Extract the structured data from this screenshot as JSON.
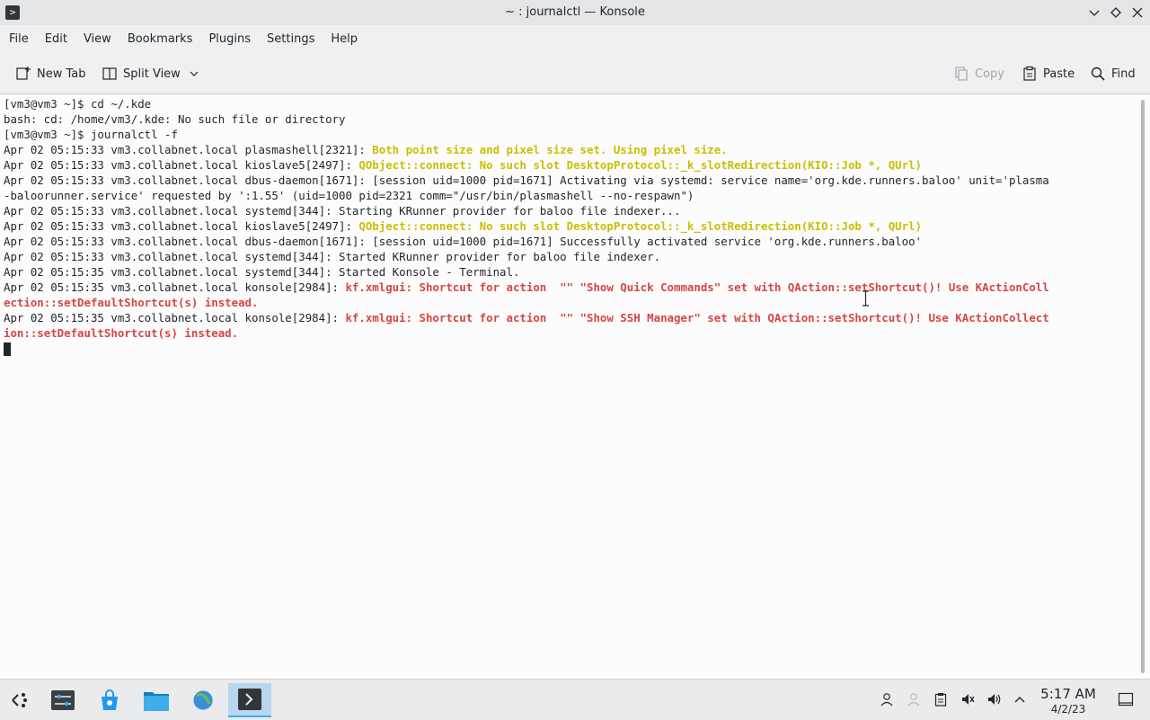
{
  "window": {
    "title": "~ : journalctl — Konsole",
    "app_icon": ">"
  },
  "window_controls": [
    "minimize",
    "maximize",
    "close"
  ],
  "menubar": {
    "items": [
      "File",
      "Edit",
      "View",
      "Bookmarks",
      "Plugins",
      "Settings",
      "Help"
    ]
  },
  "toolbar": {
    "new_tab": "New Tab",
    "split_view": "Split View",
    "copy": "Copy",
    "paste": "Paste",
    "find": "Find"
  },
  "terminal": {
    "lines": [
      {
        "prefix": "[vm3@vm3 ~]$ cd ~/.kde",
        "msg": "",
        "style": ""
      },
      {
        "prefix": "bash: cd: /home/vm3/.kde: No such file or directory",
        "msg": "",
        "style": ""
      },
      {
        "prefix": "[vm3@vm3 ~]$ journalctl -f",
        "msg": "",
        "style": ""
      },
      {
        "prefix": "Apr 02 05:15:33 vm3.collabnet.local plasmashell[2321]: ",
        "msg": "Both point size and pixel size set. Using pixel size.",
        "style": "yellow"
      },
      {
        "prefix": "Apr 02 05:15:33 vm3.collabnet.local kioslave5[2497]: ",
        "msg": "QObject::connect: No such slot DesktopProtocol::_k_slotRedirection(KIO::Job *, QUrl)",
        "style": "yellow"
      },
      {
        "prefix": "Apr 02 05:15:33 vm3.collabnet.local dbus-daemon[1671]: [session uid=1000 pid=1671] Activating via systemd: service name='org.kde.runners.baloo' unit='plasma",
        "msg": "",
        "style": ""
      },
      {
        "prefix": "-baloorunner.service' requested by ':1.55' (uid=1000 pid=2321 comm=\"/usr/bin/plasmashell --no-respawn\")",
        "msg": "",
        "style": ""
      },
      {
        "prefix": "Apr 02 05:15:33 vm3.collabnet.local systemd[344]: Starting KRunner provider for baloo file indexer...",
        "msg": "",
        "style": ""
      },
      {
        "prefix": "Apr 02 05:15:33 vm3.collabnet.local kioslave5[2497]: ",
        "msg": "QObject::connect: No such slot DesktopProtocol::_k_slotRedirection(KIO::Job *, QUrl)",
        "style": "yellow"
      },
      {
        "prefix": "Apr 02 05:15:33 vm3.collabnet.local dbus-daemon[1671]: [session uid=1000 pid=1671] Successfully activated service 'org.kde.runners.baloo'",
        "msg": "",
        "style": ""
      },
      {
        "prefix": "Apr 02 05:15:33 vm3.collabnet.local systemd[344]: Started KRunner provider for baloo file indexer.",
        "msg": "",
        "style": ""
      },
      {
        "prefix": "Apr 02 05:15:35 vm3.collabnet.local systemd[344]: Started Konsole - Terminal.",
        "msg": "",
        "style": ""
      },
      {
        "prefix": "Apr 02 05:15:35 vm3.collabnet.local konsole[2984]: ",
        "msg": "kf.xmlgui: Shortcut for action  \"\" \"Show Quick Commands\" set with QAction::setShortcut()! Use KActionColl",
        "style": "red"
      },
      {
        "prefix": "",
        "msg": "ection::setDefaultShortcut(s) instead.",
        "style": "red"
      },
      {
        "prefix": "Apr 02 05:15:35 vm3.collabnet.local konsole[2984]: ",
        "msg": "kf.xmlgui: Shortcut for action  \"\" \"Show SSH Manager\" set with QAction::setShortcut()! Use KActionCollect",
        "style": "red"
      },
      {
        "prefix": "",
        "msg": "ion::setDefaultShortcut(s) instead.",
        "style": "red"
      }
    ]
  },
  "taskbar": {
    "items": [
      "application-launcher-icon",
      "system-settings-icon",
      "discover-icon",
      "dolphin-icon",
      "firefox-icon",
      "konsole-icon"
    ],
    "tray": [
      "user-icon",
      "network-icon",
      "clipboard-icon",
      "muted-mic-icon",
      "volume-icon",
      "expand-tray-icon"
    ],
    "clock_time": "5:17 AM",
    "clock_date": "4/2/23"
  },
  "colors": {
    "warning": "#c9bf00",
    "error": "#d64545",
    "accent": "#3daee9"
  }
}
